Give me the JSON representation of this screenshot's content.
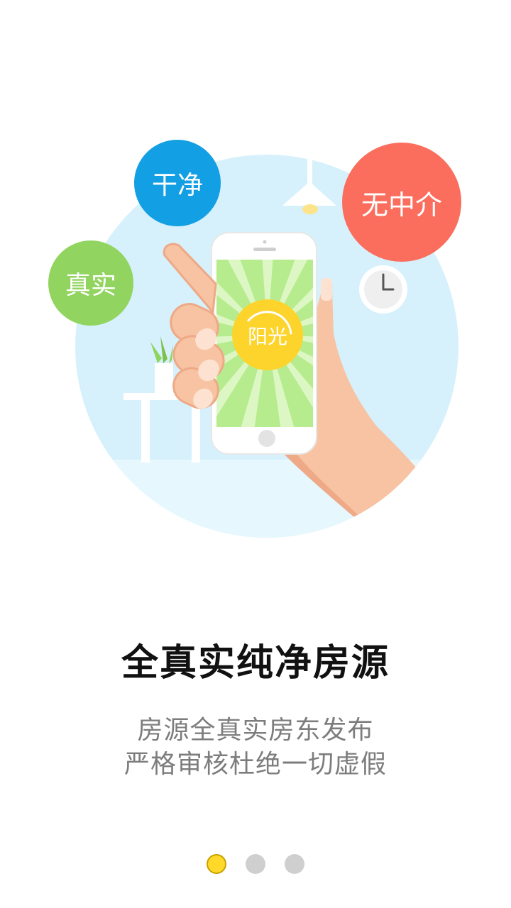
{
  "illustration": {
    "badges": {
      "clean": "干净",
      "real": "真实",
      "no_agent": "无中介"
    },
    "phone_screen_label": "阳光"
  },
  "onboarding": {
    "title": "全真实纯净房源",
    "description_line1": "房源全真实房东发布",
    "description_line2": "严格审核杜绝一切虚假"
  },
  "pager": {
    "current_page": 1,
    "total_pages": 3,
    "active_color": "#ffd829",
    "inactive_color": "#cfcfcf"
  },
  "colors": {
    "background_circle": "#d6f1fc",
    "badge_clean": "#139fe4",
    "badge_real": "#91d45f",
    "badge_no_agent": "#fb6d5d"
  }
}
